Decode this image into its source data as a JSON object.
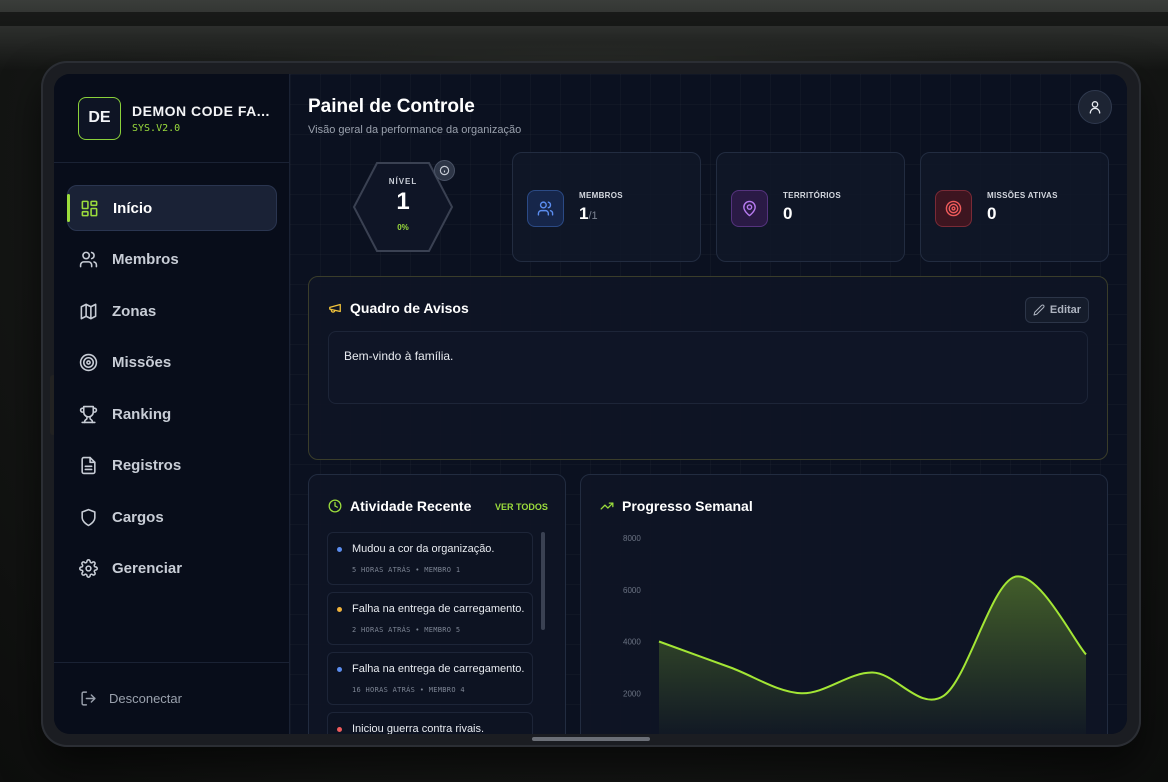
{
  "brand": {
    "logo": "DE",
    "name": "DEMON CODE FA...",
    "version": "SYS.V2.0"
  },
  "nav": [
    {
      "label": "Início",
      "icon": "dashboard-icon",
      "active": true
    },
    {
      "label": "Membros",
      "icon": "users-icon"
    },
    {
      "label": "Zonas",
      "icon": "map-icon"
    },
    {
      "label": "Missões",
      "icon": "target-icon"
    },
    {
      "label": "Ranking",
      "icon": "trophy-icon"
    },
    {
      "label": "Registros",
      "icon": "document-icon"
    },
    {
      "label": "Cargos",
      "icon": "shield-icon"
    },
    {
      "label": "Gerenciar",
      "icon": "gear-icon"
    }
  ],
  "logout": "Desconectar",
  "header": {
    "title": "Painel de Controle",
    "subtitle": "Visão geral da performance da organização"
  },
  "level": {
    "label": "NÍVEL",
    "value": "1",
    "progress": "0%"
  },
  "stats": [
    {
      "label": "MEMBROS",
      "value": "1",
      "sub": "/1",
      "icon": "users-icon",
      "color": "#5b8def"
    },
    {
      "label": "TERRITÓRIOS",
      "value": "0",
      "sub": "",
      "icon": "map-pin-icon",
      "color": "#b77bf0"
    },
    {
      "label": "MISSÕES ATIVAS",
      "value": "0",
      "sub": "",
      "icon": "target-icon",
      "color": "#ef5b5b"
    }
  ],
  "board": {
    "title": "Quadro de Avisos",
    "edit_label": "Editar",
    "message": "Bem-vindo à família."
  },
  "activity": {
    "title": "Atividade Recente",
    "see_all": "VER TODOS",
    "items": [
      {
        "text": "Mudou a cor da organização.",
        "meta": "5 HORAS ATRÁS • MEMBRO 1",
        "color": "#5b8def"
      },
      {
        "text": "Falha na entrega de carregamento.",
        "meta": "2 HORAS ATRÁS • MEMBRO 5",
        "color": "#f0b23a"
      },
      {
        "text": "Falha na entrega de carregamento.",
        "meta": "16 HORAS ATRÁS • MEMBRO 4",
        "color": "#5b8def"
      },
      {
        "text": "Iniciou guerra contra rivais.",
        "meta": "",
        "color": "#ef5b5b"
      }
    ]
  },
  "chart_data": {
    "type": "area",
    "title": "Progresso Semanal",
    "x": [
      0,
      1,
      2,
      3,
      4,
      5,
      6
    ],
    "values": [
      4000,
      3000,
      2000,
      2800,
      1900,
      6500,
      3500
    ],
    "y_ticks": [
      "8000",
      "6000",
      "4000",
      "2000"
    ],
    "ylim": [
      0,
      8000
    ],
    "color": "#a3e635"
  }
}
